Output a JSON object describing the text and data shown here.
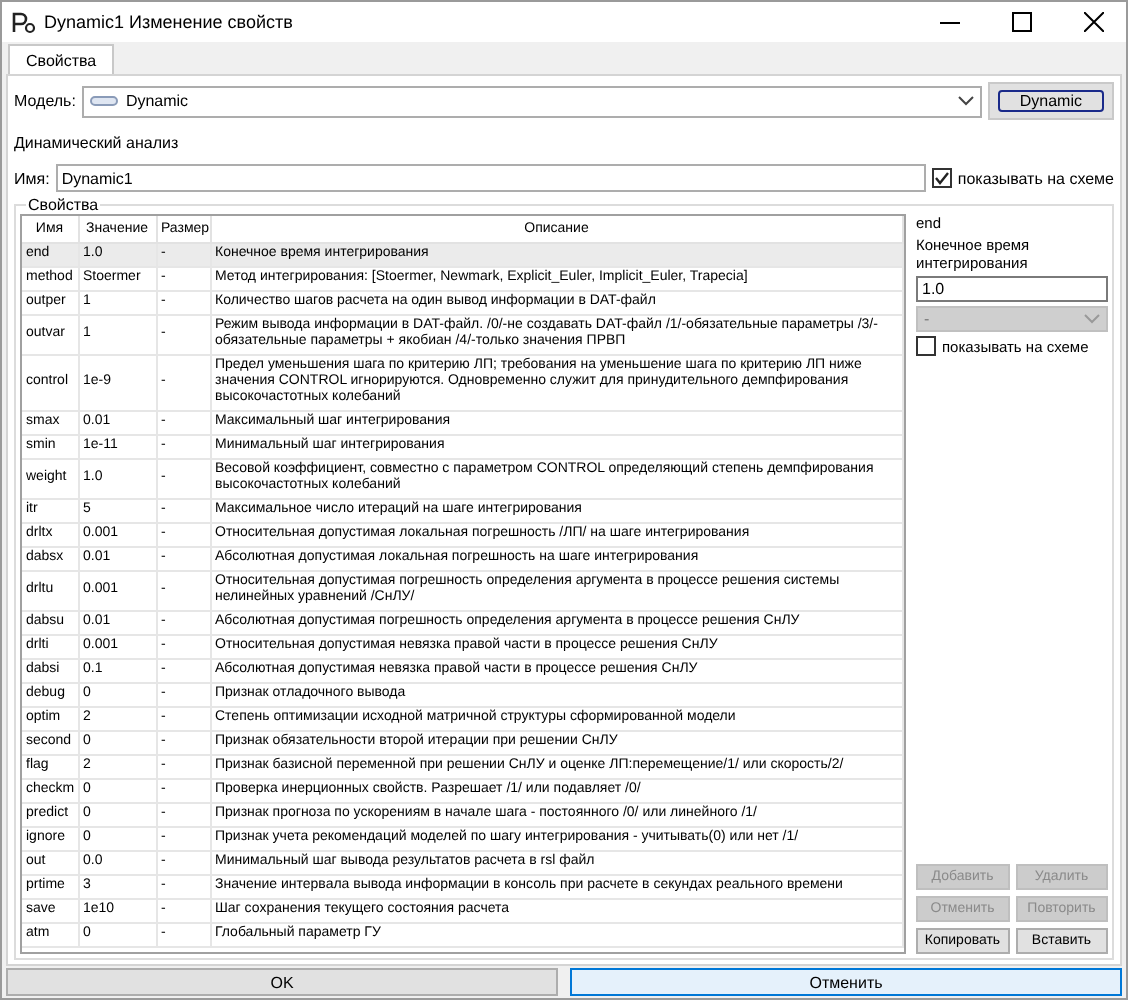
{
  "window": {
    "title": "Dynamic1 Изменение свойств"
  },
  "tabs": [
    {
      "label": "Свойства",
      "selected": true
    }
  ],
  "model": {
    "label": "Модель:",
    "value": "Dynamic",
    "button": "Dynamic"
  },
  "analysis_label": "Динамический анализ",
  "name": {
    "label": "Имя:",
    "value": "Dynamic1",
    "show_on_scheme": {
      "label": "показывать на схеме",
      "checked": true
    }
  },
  "properties": {
    "title": "Свойства",
    "columns": [
      "Имя",
      "Значение",
      "Размер",
      "Описание"
    ],
    "rows": [
      {
        "name": "end",
        "value": "1.0",
        "size": "-",
        "description": "Конечное время интегрирования",
        "selected": true
      },
      {
        "name": "method",
        "value": "Stoermer",
        "size": "-",
        "description": "Метод интегрирования: [Stoermer, Newmark, Explicit_Euler, Implicit_Euler, Trapecia]",
        "selected": false
      },
      {
        "name": "outper",
        "value": "1",
        "size": "-",
        "description": "Количество шагов расчета на один вывод информации в DAT-файл",
        "selected": false
      },
      {
        "name": "outvar",
        "value": "1",
        "size": "-",
        "description": "Режим вывода информации в DAT-файл. /0/-не создавать DAT-файл /1/-обязательные параметры /3/-обязательные параметры + якобиан /4/-только значения ПРВП",
        "selected": false
      },
      {
        "name": "control",
        "value": "1e-9",
        "size": "-",
        "description": "Предел уменьшения шага по критерию ЛП; требования на уменьшение шага по критерию ЛП ниже значения CONTROL игнорируются. Одновременно служит для принудительного демпфирования высокочастотных колебаний",
        "selected": false
      },
      {
        "name": "smax",
        "value": "0.01",
        "size": "-",
        "description": "Максимальный шаг интегрирования",
        "selected": false
      },
      {
        "name": "smin",
        "value": "1e-11",
        "size": "-",
        "description": "Минимальный шаг интегрирования",
        "selected": false
      },
      {
        "name": "weight",
        "value": "1.0",
        "size": "-",
        "description": "Весовой коэффициент, совместно с параметром CONTROL определяющий степень демпфирования высокочастотных колебаний",
        "selected": false
      },
      {
        "name": "itr",
        "value": "5",
        "size": "-",
        "description": "Максимальное число итераций на шаге интегрирования",
        "selected": false
      },
      {
        "name": "drltx",
        "value": "0.001",
        "size": "-",
        "description": "Относительная допустимая локальная погрешность /ЛП/ на шаге интегрирования",
        "selected": false
      },
      {
        "name": "dabsx",
        "value": "0.01",
        "size": "-",
        "description": "Абсолютная допустимая локальная погрешность на шаге интегрирования",
        "selected": false
      },
      {
        "name": "drltu",
        "value": "0.001",
        "size": "-",
        "description": "Относительная допустимая погрешность определения аргумента в процессе решения системы нелинейных уравнений /СнЛУ/",
        "selected": false
      },
      {
        "name": "dabsu",
        "value": "0.01",
        "size": "-",
        "description": "Абсолютная допустимая погрешность определения аргумента в процессе решения СнЛУ",
        "selected": false
      },
      {
        "name": "drlti",
        "value": "0.001",
        "size": "-",
        "description": "Относительная допустимая невязка правой части в процессе решения СнЛУ",
        "selected": false
      },
      {
        "name": "dabsi",
        "value": "0.1",
        "size": "-",
        "description": "Абсолютная  допустимая невязка правой части в процессе решения СнЛУ",
        "selected": false
      },
      {
        "name": "debug",
        "value": "0",
        "size": "-",
        "description": "Признак отладочного вывода",
        "selected": false
      },
      {
        "name": "optim",
        "value": "2",
        "size": "-",
        "description": "Степень оптимизации исходной матричной структуры сформированной модели",
        "selected": false
      },
      {
        "name": "second",
        "value": "0",
        "size": "-",
        "description": "Признак обязательности второй итерации при решении СнЛУ",
        "selected": false
      },
      {
        "name": "flag",
        "value": "2",
        "size": "-",
        "description": "Признак базисной переменной при решении СнЛУ и оценке ЛП:перемещение/1/ или скорость/2/",
        "selected": false
      },
      {
        "name": "checkm",
        "value": "0",
        "size": "-",
        "description": "Проверка инерционных свойств. Разрешает /1/ или подавляет  /0/",
        "selected": false
      },
      {
        "name": "predict",
        "value": "0",
        "size": "-",
        "description": "Признак прогноза по ускорениям в начале шага - постоянного /0/ или линейного /1/",
        "selected": false
      },
      {
        "name": "ignore",
        "value": "0",
        "size": "-",
        "description": "Признак учета рекомендаций моделей по шагу интегрирования - учитывать(0) или нет /1/",
        "selected": false
      },
      {
        "name": "out",
        "value": "0.0",
        "size": "-",
        "description": "Минимальный шаг вывода результатов расчета в rsl файл",
        "selected": false
      },
      {
        "name": "prtime",
        "value": "3",
        "size": "-",
        "description": "Значение интервала вывода информации в консоль при расчете в секундах реального времени",
        "selected": false
      },
      {
        "name": "save",
        "value": "1e10",
        "size": "-",
        "description": "Шаг сохранения текущего состояния расчета",
        "selected": false
      },
      {
        "name": "atm",
        "value": "0",
        "size": "-",
        "description": "Глобальный параметр ГУ",
        "selected": false
      }
    ]
  },
  "details": {
    "name": "end",
    "description": "Конечное время интегрирования",
    "value": "1.0",
    "unit": {
      "value": "-",
      "disabled": true
    },
    "show_on_scheme": {
      "label": "показывать на схеме",
      "checked": false
    },
    "buttons": [
      {
        "label": "Добавить",
        "disabled": true
      },
      {
        "label": "Удалить",
        "disabled": true
      },
      {
        "label": "Отменить",
        "disabled": true
      },
      {
        "label": "Повторить",
        "disabled": true
      },
      {
        "label": "Копировать",
        "disabled": false
      },
      {
        "label": "Вставить",
        "disabled": false
      }
    ]
  },
  "footer": {
    "buttons": [
      {
        "label": "OK",
        "focused": false
      },
      {
        "label": "Отменить",
        "focused": true
      }
    ]
  }
}
